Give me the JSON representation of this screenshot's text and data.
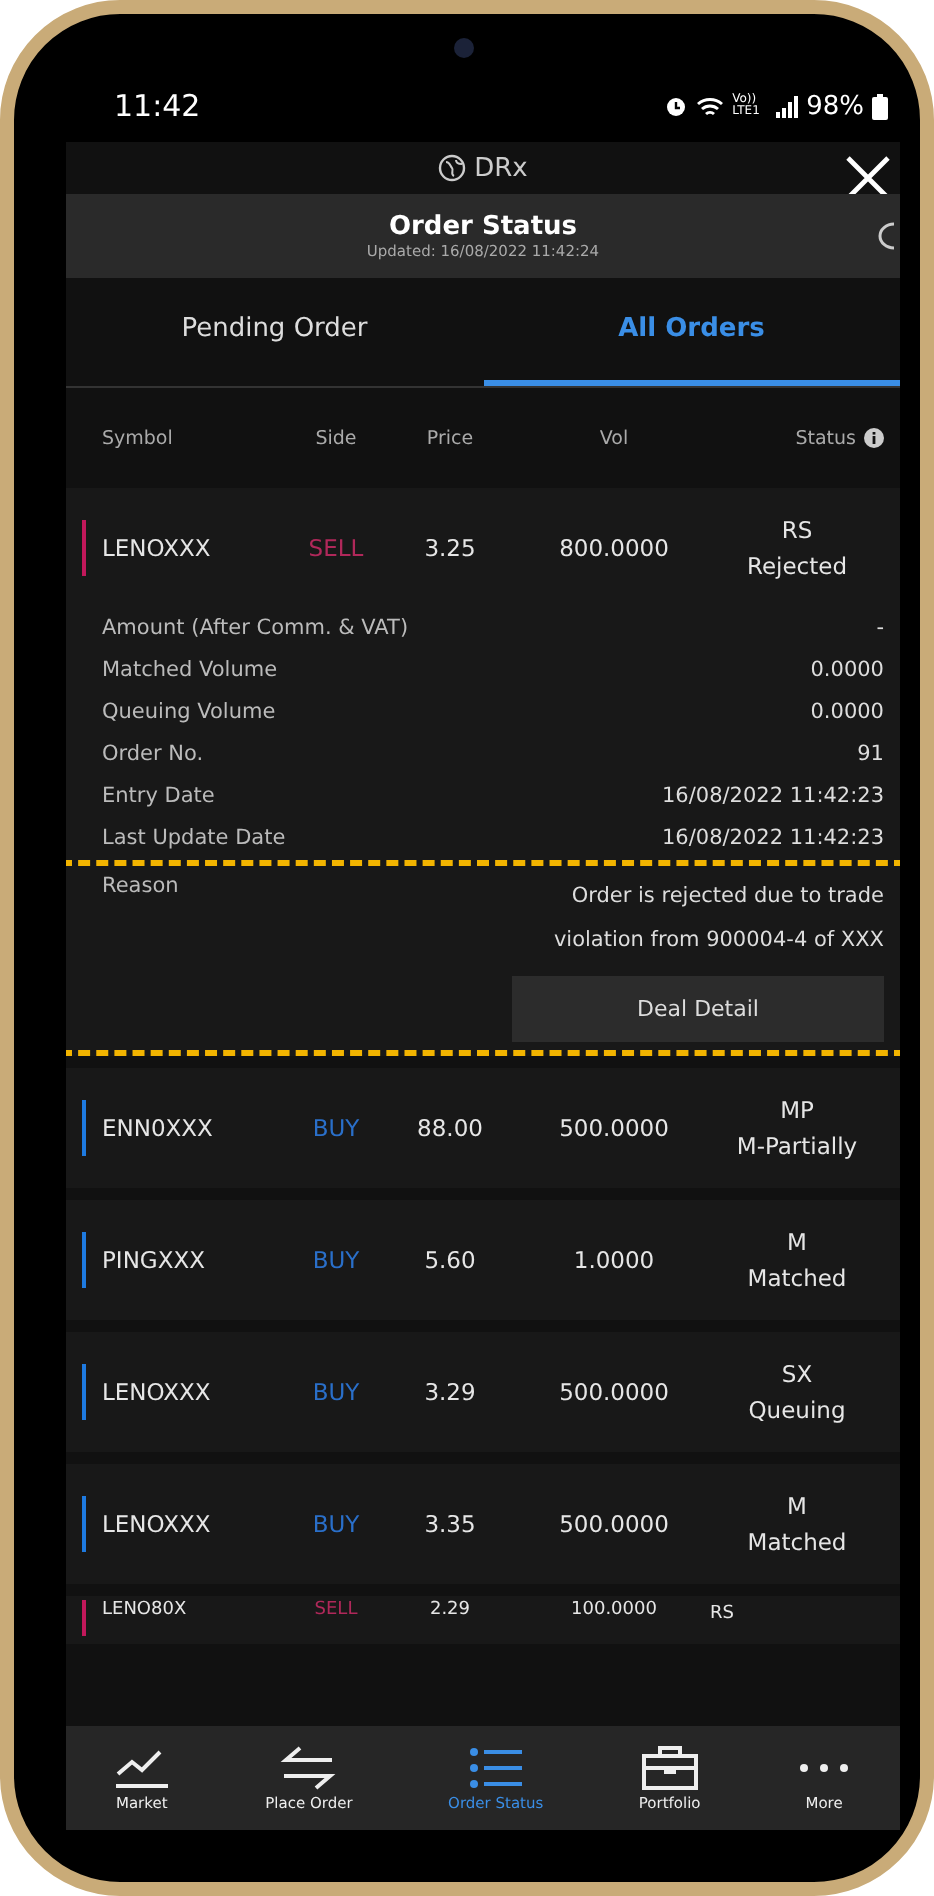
{
  "status_bar": {
    "time": "11:42",
    "network": "Vo)) LTE1",
    "battery": "98%"
  },
  "app_header": {
    "title": "DRx"
  },
  "title_bar": {
    "title": "Order Status",
    "updated": "Updated: 16/08/2022 11:42:24"
  },
  "tabs": [
    {
      "label": "Pending Order",
      "selected": false
    },
    {
      "label": "All Orders",
      "selected": true
    }
  ],
  "table": {
    "columns": [
      "Symbol",
      "Side",
      "Price",
      "Vol",
      "Status"
    ],
    "rows": [
      {
        "symbol": "LENOXXX",
        "side": "SELL",
        "kind": "sell",
        "price": "3.25",
        "vol": "800.0000",
        "status_code": "RS",
        "status": "Rejected",
        "expanded": true,
        "details": [
          {
            "label": "Amount (After Comm. & VAT)",
            "value": "-"
          },
          {
            "label": "Matched Volume",
            "value": "0.0000"
          },
          {
            "label": "Queuing Volume",
            "value": "0.0000"
          },
          {
            "label": "Order No.",
            "value": "91"
          },
          {
            "label": "Entry Date",
            "value": "16/08/2022 11:42:23"
          },
          {
            "label": "Last Update Date",
            "value": "16/08/2022 11:42:23"
          }
        ],
        "reason": {
          "label": "Reason",
          "text": "Order is rejected due to trade violation from 900004-4 of XXX",
          "highlighted": true
        },
        "button": "Deal Detail"
      },
      {
        "symbol": "ENN0XXX",
        "side": "BUY",
        "kind": "buy",
        "price": "88.00",
        "vol": "500.0000",
        "status_code": "MP",
        "status": "M-Partially",
        "expanded": false
      },
      {
        "symbol": "PINGXXX",
        "side": "BUY",
        "kind": "buy",
        "price": "5.60",
        "vol": "1.0000",
        "status_code": "M",
        "status": "Matched",
        "expanded": false
      },
      {
        "symbol": "LENOXXX",
        "side": "BUY",
        "kind": "buy",
        "price": "3.29",
        "vol": "500.0000",
        "status_code": "SX",
        "status": "Queuing",
        "expanded": false
      },
      {
        "symbol": "LENOXXX",
        "side": "BUY",
        "kind": "buy",
        "price": "3.35",
        "vol": "500.0000",
        "status_code": "M",
        "status": "Matched",
        "expanded": false
      },
      {
        "symbol": "LENO80X",
        "side": "SELL",
        "kind": "sell",
        "price": "2.29",
        "vol": "100.0000",
        "status_code": "RS",
        "expanded": false
      }
    ]
  },
  "nav": [
    {
      "label": "Market",
      "kind": "chart",
      "selected": false
    },
    {
      "label": "Place Order",
      "kind": "swap",
      "selected": false
    },
    {
      "label": "Order Status",
      "kind": "list",
      "selected": true
    },
    {
      "label": "Portfolio",
      "kind": "briefcase",
      "selected": false
    },
    {
      "label": "More",
      "kind": "dots",
      "selected": false
    }
  ]
}
